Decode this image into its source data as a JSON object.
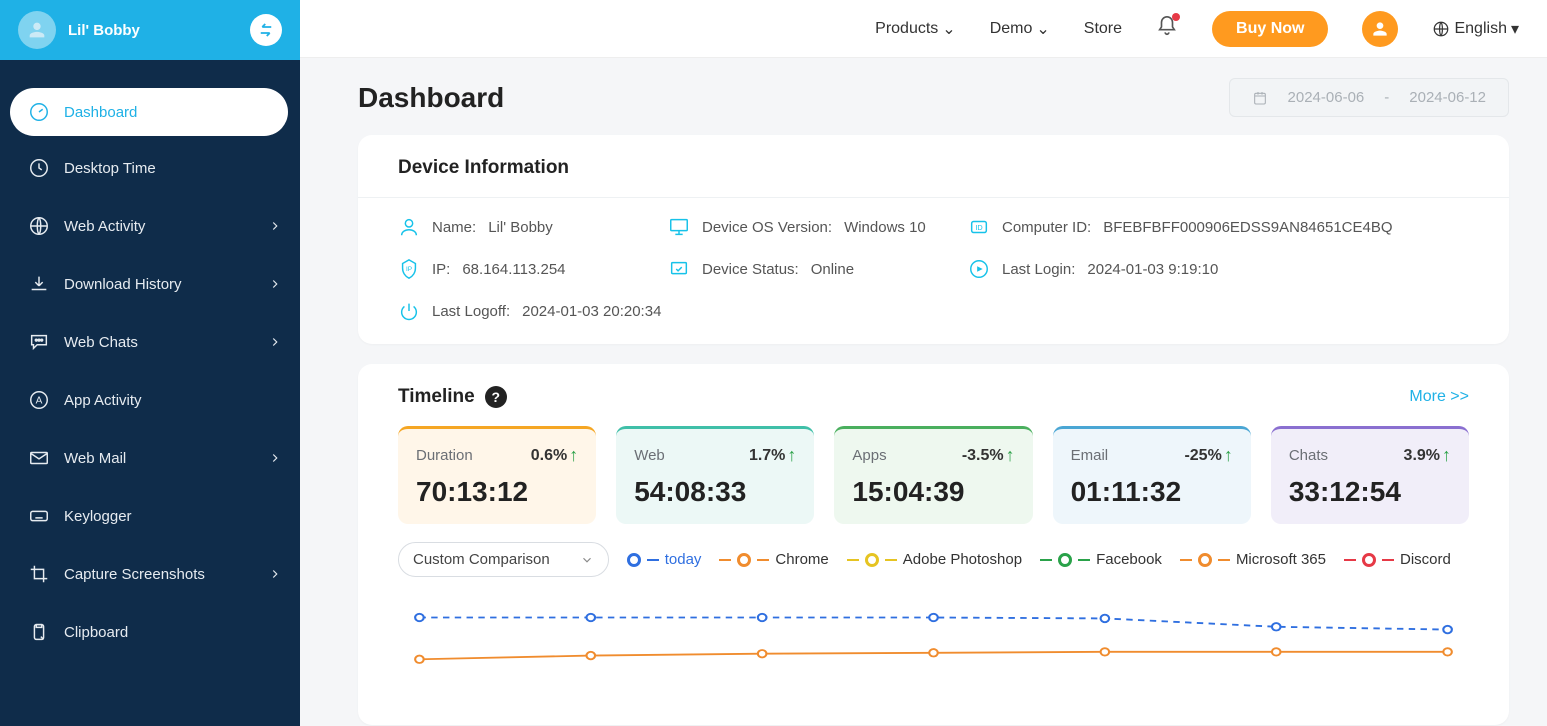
{
  "user": {
    "name": "Lil' Bobby"
  },
  "topnav": {
    "products": "Products",
    "demo": "Demo",
    "store": "Store",
    "buy": "Buy Now",
    "language": "English"
  },
  "sidebar": {
    "items": [
      {
        "label": "Dashboard",
        "active": true
      },
      {
        "label": "Desktop Time"
      },
      {
        "label": "Web Activity",
        "chev": true
      },
      {
        "label": "Download History",
        "chev": true
      },
      {
        "label": "Web Chats",
        "chev": true
      },
      {
        "label": "App Activity"
      },
      {
        "label": "Web Mail",
        "chev": true
      },
      {
        "label": "Keylogger"
      },
      {
        "label": "Capture Screenshots",
        "chev": true
      },
      {
        "label": "Clipboard"
      }
    ]
  },
  "page": {
    "title": "Dashboard"
  },
  "date_range": {
    "from": "2024-06-06",
    "dash": "-",
    "to": "2024-06-12"
  },
  "device_info": {
    "title": "Device Information",
    "name_label": "Name: ",
    "name": "Lil' Bobby",
    "os_label": "Device OS Version: ",
    "os": "Windows 10",
    "id_label": "Computer ID: ",
    "id": "BFEBFBFF000906EDSS9AN84651CE4BQ",
    "ip_label": "IP: ",
    "ip": "68.164.113.254",
    "status_label": "Device Status: ",
    "status": "Online",
    "login_label": "Last Login: ",
    "login": "2024-01-03 9:19:10",
    "logoff_label": "Last Logoff: ",
    "logoff": "2024-01-03 20:20:34"
  },
  "timeline": {
    "title": "Timeline",
    "more": "More >>",
    "dropdown": "Custom Comparison",
    "stats": [
      {
        "name": "Duration",
        "pct": "0.6%",
        "value": "70:13:12"
      },
      {
        "name": "Web",
        "pct": "1.7%",
        "value": "54:08:33"
      },
      {
        "name": "Apps",
        "pct": "-3.5%",
        "value": "15:04:39"
      },
      {
        "name": "Email",
        "pct": "-25%",
        "value": "01:11:32"
      },
      {
        "name": "Chats",
        "pct": "3.9%",
        "value": "33:12:54"
      }
    ],
    "legend": [
      "today",
      "Chrome",
      "Adobe Photoshop",
      "Facebook",
      "Microsoft 365",
      "Discord"
    ]
  },
  "chart_data": {
    "type": "line",
    "x": [
      0,
      1,
      2,
      3,
      4,
      5,
      6
    ],
    "series": [
      {
        "name": "today",
        "color": "#2f6fe0",
        "style": "dashed",
        "values": [
          85,
          85,
          85,
          85,
          84,
          75,
          72
        ]
      },
      {
        "name": "Chrome",
        "color": "#f08c2e",
        "style": "solid",
        "values": [
          40,
          44,
          46,
          47,
          48,
          48,
          48
        ]
      }
    ],
    "ylim": [
      0,
      100
    ]
  }
}
